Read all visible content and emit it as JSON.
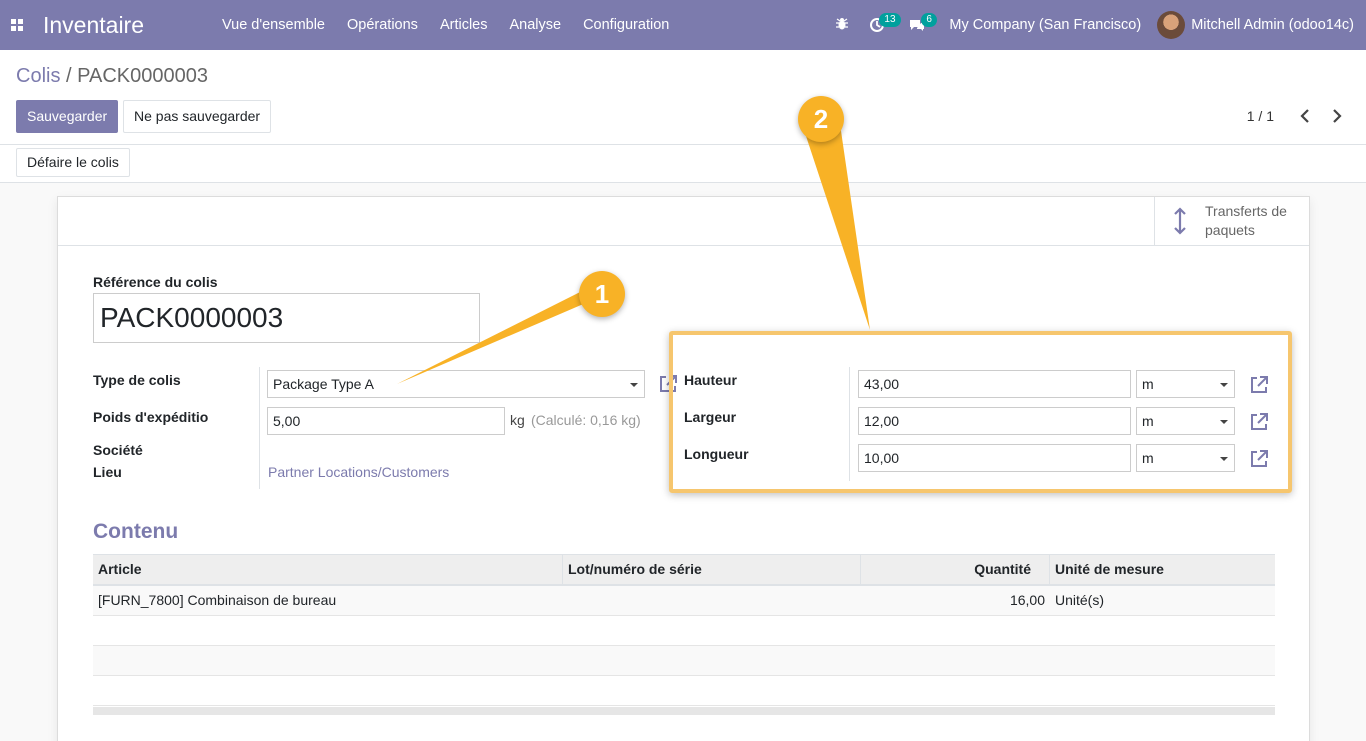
{
  "navbar": {
    "brand": "Inventaire",
    "menu": [
      "Vue d'ensemble",
      "Opérations",
      "Articles",
      "Analyse",
      "Configuration"
    ],
    "activity_count": "13",
    "message_count": "6",
    "company": "My Company (San Francisco)",
    "user": "Mitchell Admin (odoo14c)"
  },
  "breadcrumb": {
    "parent": "Colis",
    "separator": "/",
    "current": "PACK0000003"
  },
  "actions": {
    "save": "Sauvegarder",
    "discard": "Ne pas sauvegarder",
    "undo_package": "Défaire le colis"
  },
  "pager": {
    "value": "1 / 1"
  },
  "smart_button": {
    "line1": "Transferts de",
    "line2": "paquets"
  },
  "form": {
    "reference_label": "Référence du colis",
    "reference_value": "PACK0000003",
    "package_type_label": "Type de colis",
    "package_type_value": "Package Type A",
    "weight_label": "Poids d'expéditio",
    "weight_value": "5,00",
    "weight_unit": "kg",
    "weight_computed": "(Calculé: 0,16  kg)",
    "company_label": "Société",
    "location_label": "Lieu",
    "location_value": "Partner Locations/Customers",
    "height_label": "Hauteur",
    "height_value": "43,00",
    "height_uom": "m",
    "width_label": "Largeur",
    "width_value": "12,00",
    "width_uom": "m",
    "length_label": "Longueur",
    "length_value": "10,00",
    "length_uom": "m"
  },
  "content": {
    "title": "Contenu",
    "columns": [
      "Article",
      "Lot/numéro de série",
      "Quantité",
      "Unité de mesure"
    ],
    "rows": [
      {
        "article": "[FURN_7800] Combinaison de bureau",
        "lot": "",
        "qty": "16,00",
        "uom": "Unité(s)"
      }
    ]
  },
  "annotations": {
    "callout1": "1",
    "callout2": "2",
    "accent_color": "#f8b226"
  },
  "colors": {
    "primary": "#7c7bad",
    "badge": "#00a09d"
  }
}
